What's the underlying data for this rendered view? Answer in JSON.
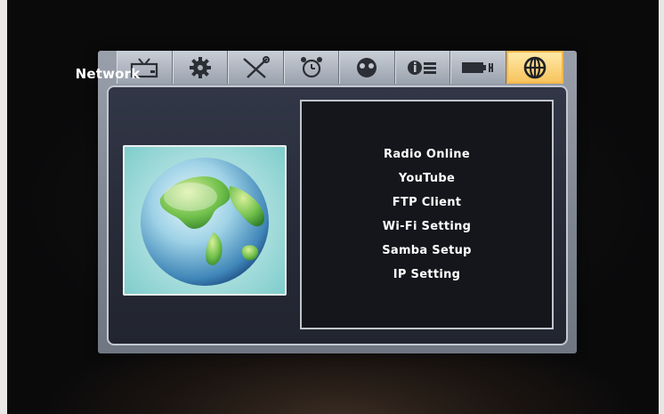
{
  "tabs": [
    {
      "icon": "tv-icon",
      "active": false
    },
    {
      "icon": "gear-icon",
      "active": false
    },
    {
      "icon": "tools-icon",
      "active": false
    },
    {
      "icon": "alarm-clock-icon",
      "active": false
    },
    {
      "icon": "eyes-icon",
      "active": false
    },
    {
      "icon": "info-icon",
      "active": false
    },
    {
      "icon": "battery-icon",
      "active": false
    },
    {
      "icon": "globe-icon",
      "active": true
    }
  ],
  "section": {
    "title": "Network",
    "image_icon": "globe-icon"
  },
  "menu": {
    "items": [
      {
        "label": "Radio Online"
      },
      {
        "label": "YouTube"
      },
      {
        "label": "FTP Client"
      },
      {
        "label": "Wi-Fi Setting"
      },
      {
        "label": "Samba Setup"
      },
      {
        "label": "IP Setting"
      }
    ]
  },
  "colors": {
    "active_tab": "#f7c45e",
    "panel": "#2a2e3b",
    "menu_bg": "#15161c",
    "text": "#ffffff"
  }
}
